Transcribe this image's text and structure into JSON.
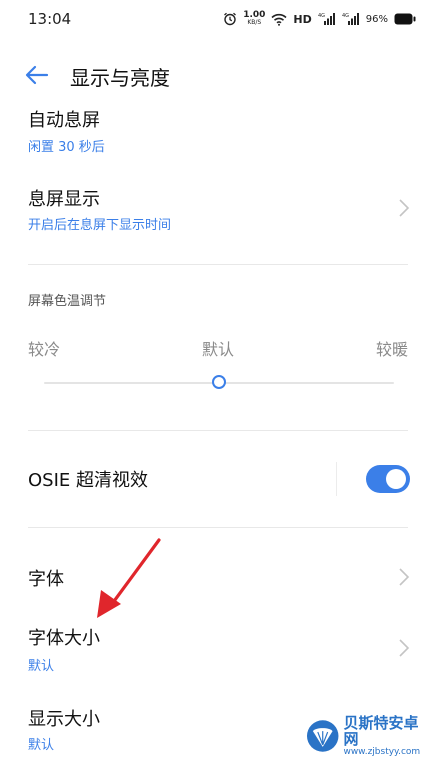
{
  "status_bar": {
    "time": "13:04",
    "speed_value": "1.00",
    "speed_unit": "KB/S",
    "hd_label": "HD",
    "battery": "96%"
  },
  "header": {
    "title": "显示与亮度"
  },
  "auto_screen_off": {
    "title": "自动息屏",
    "value": "闲置 30 秒后"
  },
  "always_on_display": {
    "title": "息屏显示",
    "subtitle": "开启后在息屏下显示时间"
  },
  "color_temperature": {
    "label": "屏幕色温调节",
    "left": "较冷",
    "center": "默认",
    "right": "较暖",
    "level": 0.5
  },
  "osie": {
    "title": "OSIE 超清视效",
    "enabled": true
  },
  "font": {
    "title": "字体"
  },
  "font_size": {
    "title": "字体大小",
    "value": "默认"
  },
  "display_size": {
    "title": "显示大小",
    "value": "默认"
  },
  "watermark": {
    "title": "贝斯特安卓网",
    "url": "www.zjbstyy.com"
  },
  "colors": {
    "accent": "#3b7fe8",
    "annotation": "#e0262c"
  }
}
